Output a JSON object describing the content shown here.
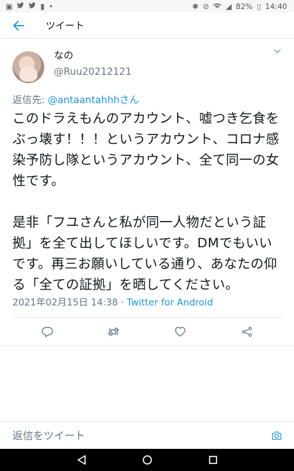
{
  "status_bar": {
    "battery": "82%",
    "time": "14:40"
  },
  "header": {
    "title": "ツイート"
  },
  "tweet": {
    "display_name": "なの",
    "handle": "@Ruu20212121",
    "reply_prefix": "返信先: ",
    "reply_mention": "@antaantahhh",
    "reply_suffix": "さん",
    "text": "このドラえもんのアカウント、嘘つき乞食をぶっ壊す！！！というアカウント、コロナ感染予防し隊というアカウント、全て同一の女性です。\n\n是非「フユさんと私が同一人物だという証拠」を全て出してほしいです。DMでもいいです。再三お願いしている通り、あなたの仰る「全ての証拠」を晒してください。",
    "timestamp": "2021年02月15日 14:38",
    "separator": " · ",
    "source": "Twitter for Android"
  },
  "reply_bar": {
    "placeholder": "返信をツイート"
  },
  "colors": {
    "link": "#1b95e0",
    "secondary": "#657786",
    "divider": "#e6ecf0"
  }
}
